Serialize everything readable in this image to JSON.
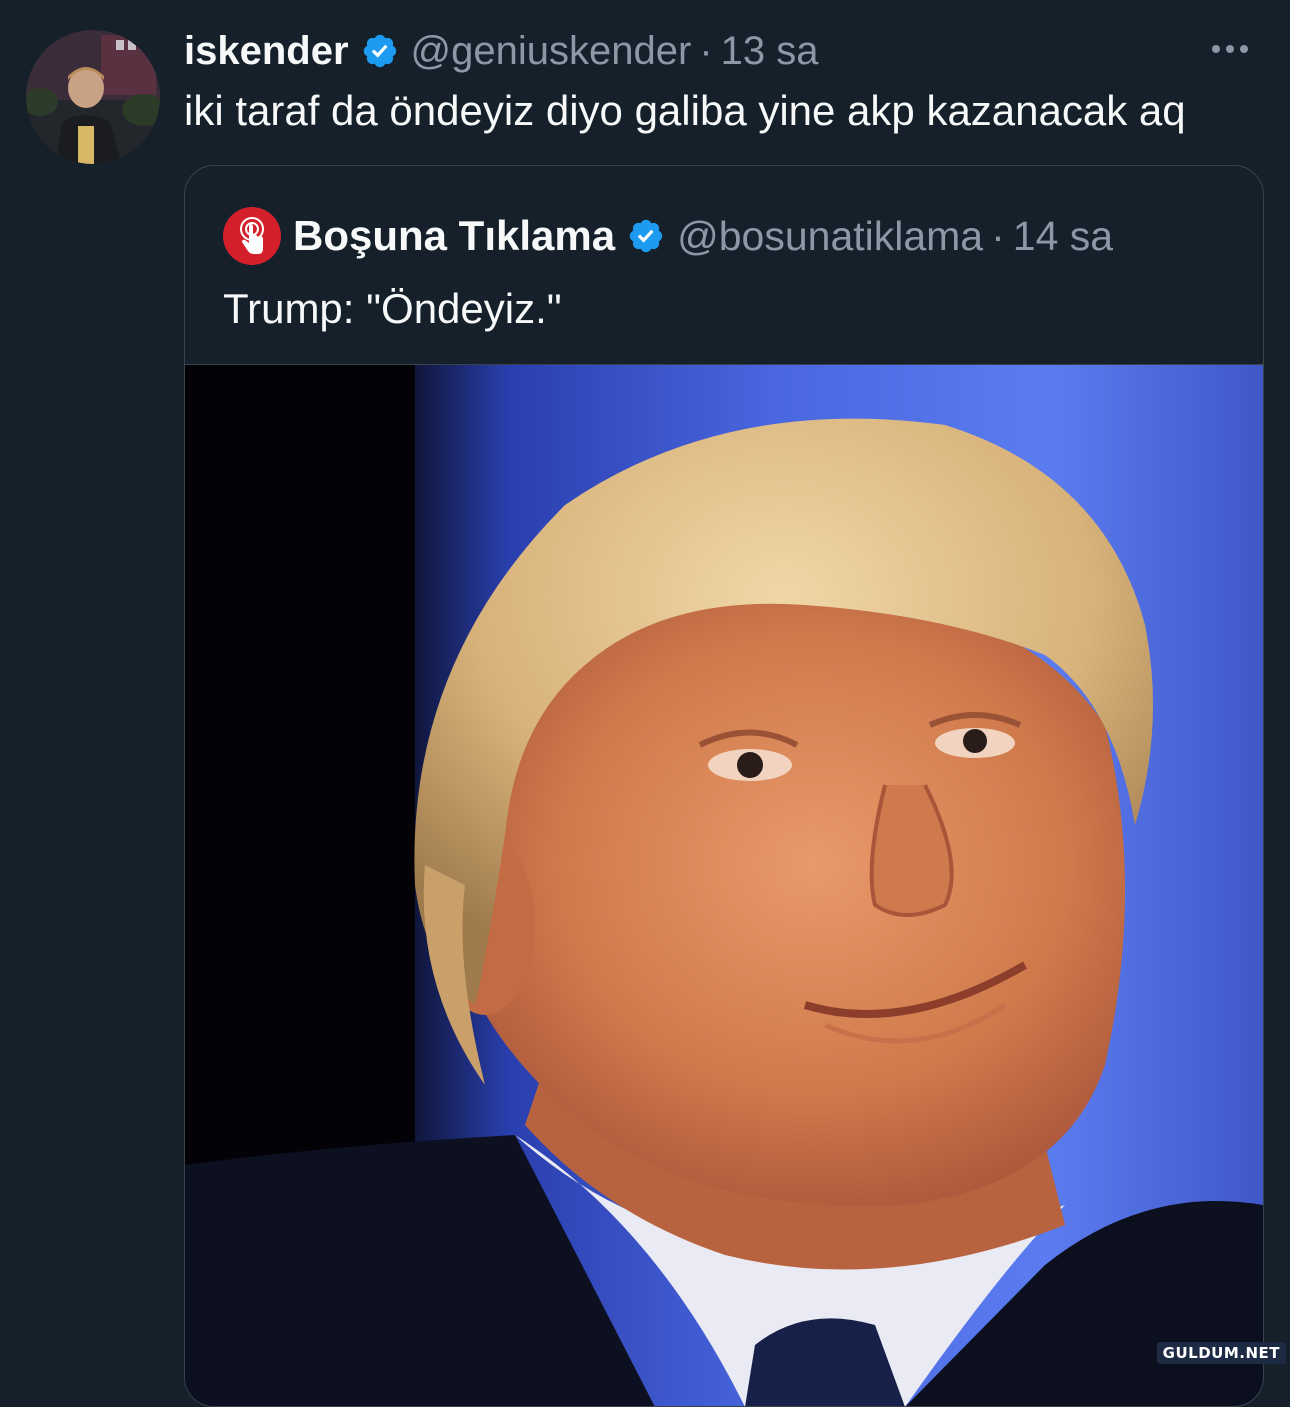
{
  "tweet": {
    "display_name": "iskender",
    "handle": "@geniuskender",
    "separator": "·",
    "time": "13 sa",
    "text": "iki taraf da öndeyiz diyo galiba yine akp kazanacak aq",
    "avatar_icon": "user-avatar-photo",
    "verified_icon": "verified-badge-icon",
    "more_icon": "more-options-icon"
  },
  "quote": {
    "display_name": "Boşuna Tıklama",
    "handle": "@bosunatiklama",
    "separator": "·",
    "time": "14 sa",
    "text": "Trump: \"Öndeyiz.\"",
    "avatar_icon": "pointer-click-logo-icon",
    "media_icon": "photo-portrait"
  },
  "watermark": "GULDUM.NET",
  "colors": {
    "background": "#15202b",
    "text_primary": "#f7f9f9",
    "text_secondary": "#8b98a5",
    "verified": "#1d9bf0",
    "border": "#38444d",
    "quote_logo": "#d3202a"
  }
}
